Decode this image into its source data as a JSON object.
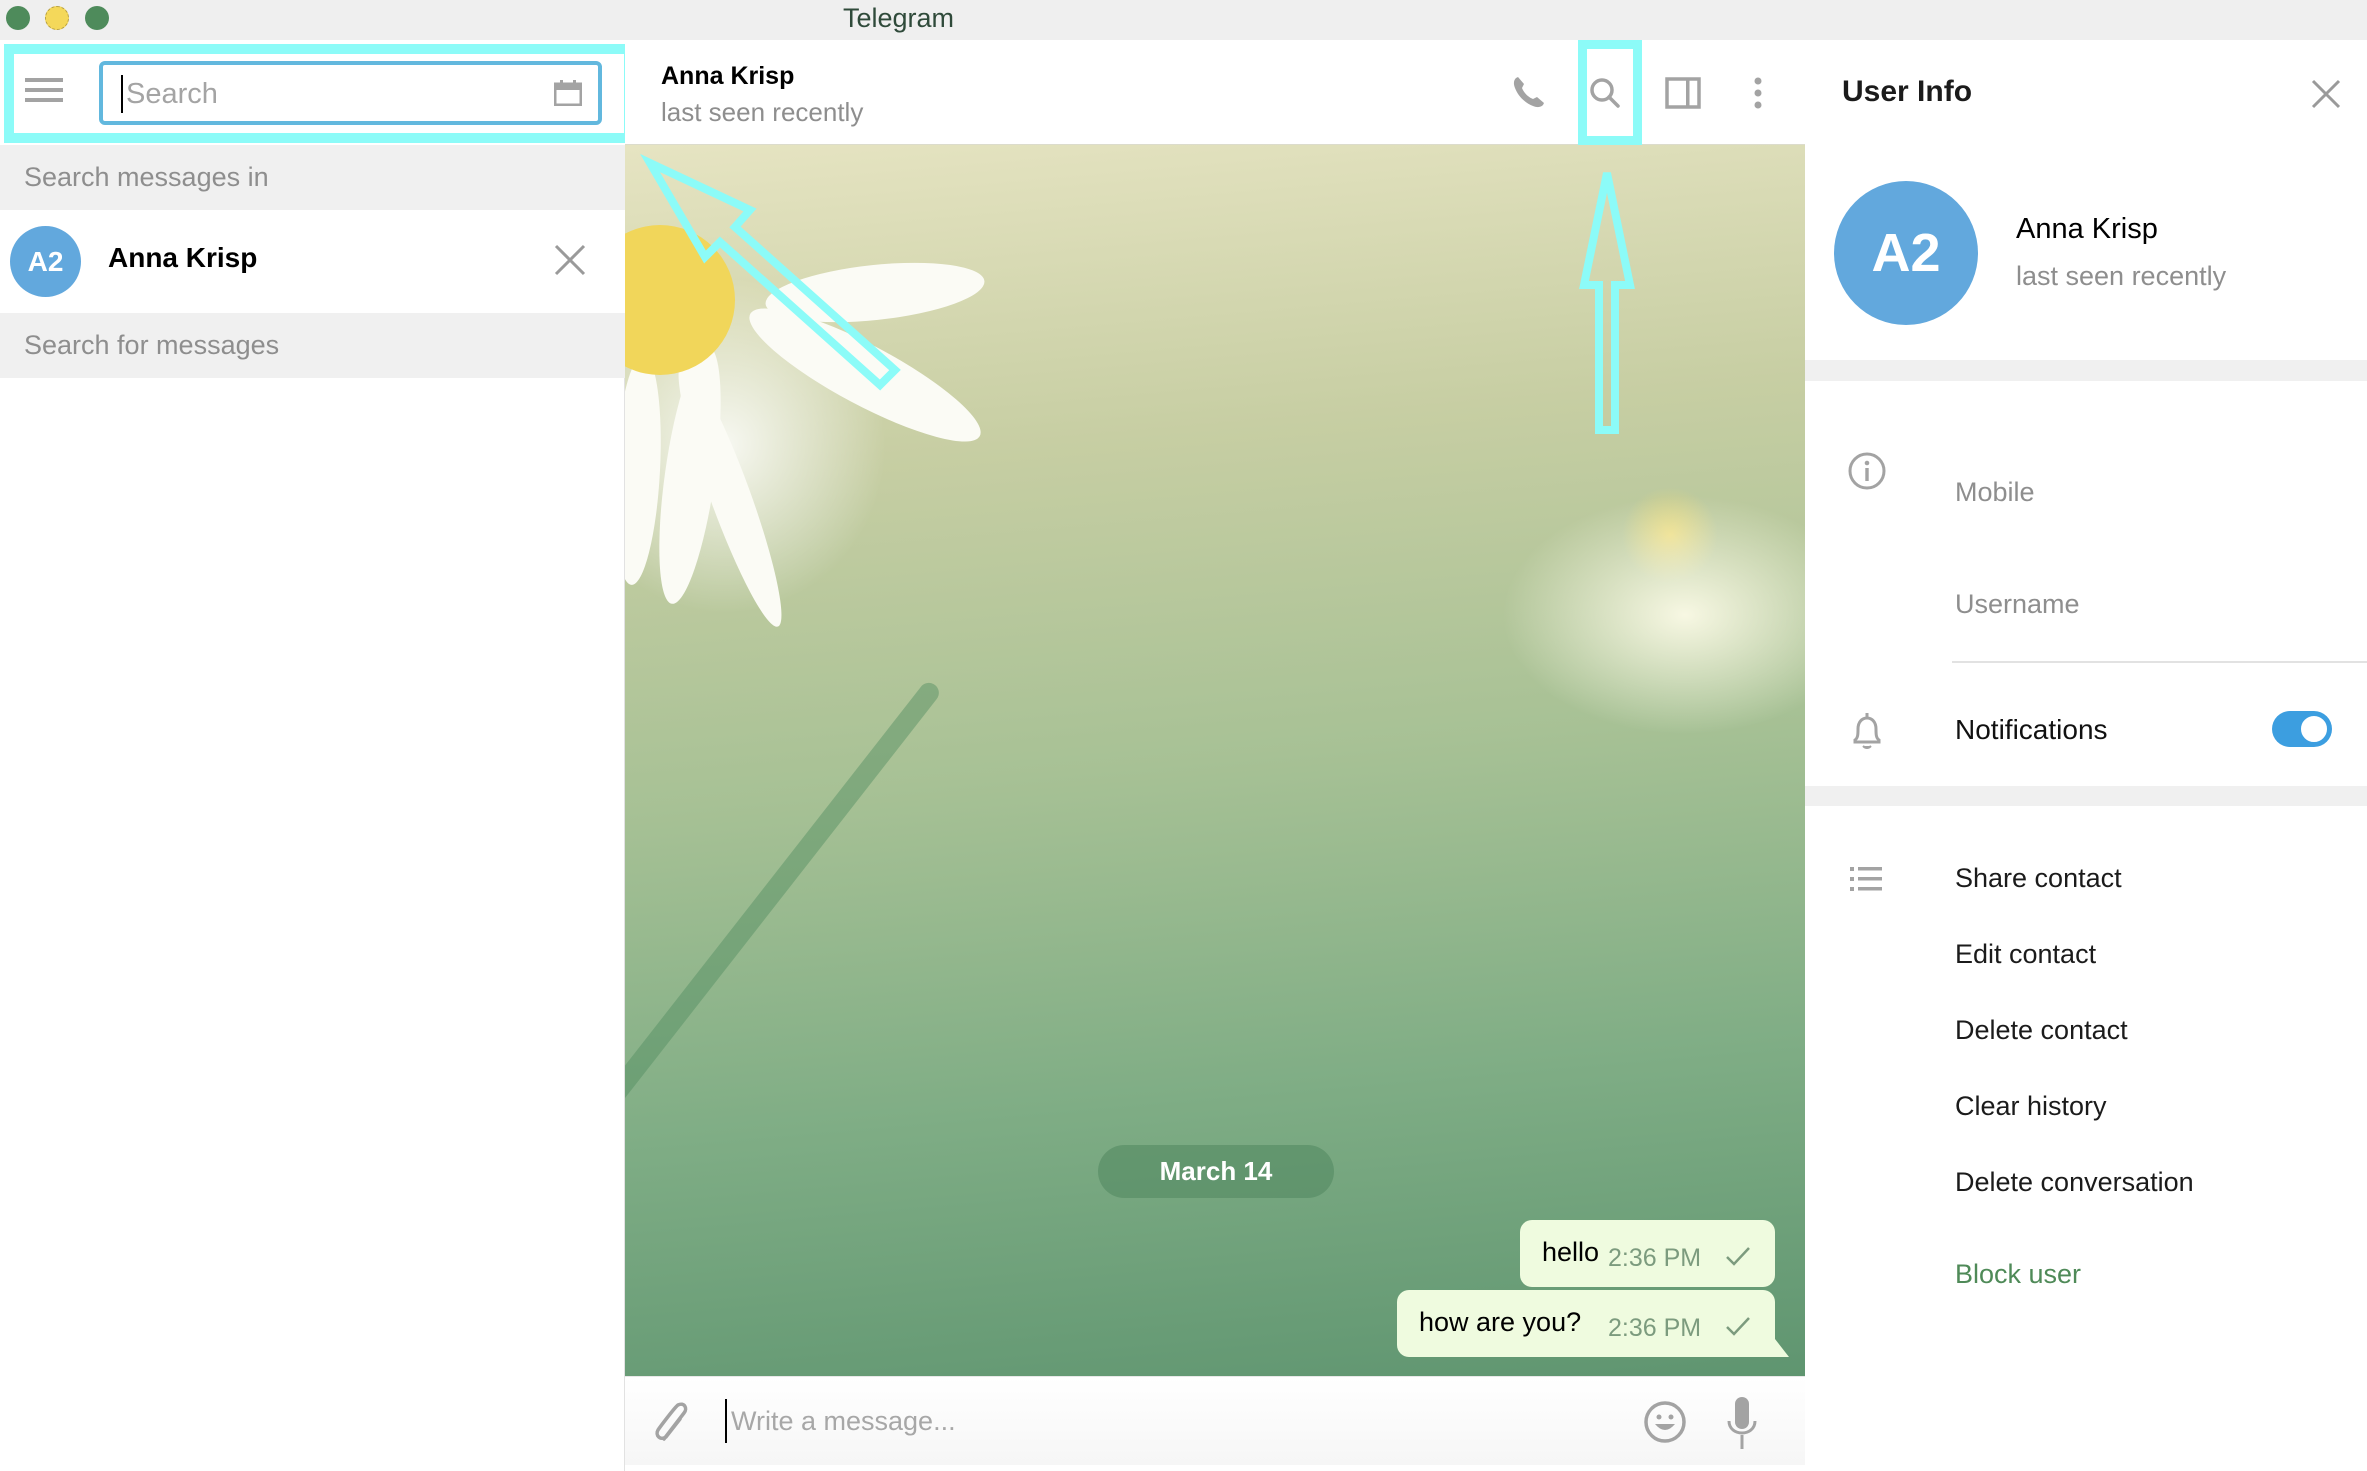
{
  "window": {
    "title": "Telegram"
  },
  "sidebar": {
    "search": {
      "placeholder": "Search",
      "value": ""
    },
    "search_messages_in_label": "Search messages in",
    "scope_chat": {
      "avatar_initials": "A2",
      "name": "Anna Krisp"
    },
    "search_for_messages_label": "Search for messages"
  },
  "chat": {
    "header": {
      "name": "Anna Krisp",
      "status": "last seen recently"
    },
    "date_separator": "March 14",
    "messages": [
      {
        "text": "hello",
        "time": "2:36 PM",
        "status": "sent"
      },
      {
        "text": "how are you?",
        "time": "2:36 PM",
        "status": "sent"
      }
    ],
    "composer": {
      "placeholder": "Write a message...",
      "value": ""
    }
  },
  "user_info": {
    "title": "User Info",
    "avatar_initials": "A2",
    "name": "Anna Krisp",
    "status": "last seen recently",
    "fields": {
      "mobile_label": "Mobile",
      "username_label": "Username"
    },
    "notifications": {
      "label": "Notifications",
      "enabled": true
    },
    "actions": [
      "Share contact",
      "Edit contact",
      "Delete contact",
      "Clear history",
      "Delete conversation"
    ],
    "block_label": "Block user"
  },
  "colors": {
    "accent": "#62a8dd",
    "toggle_on": "#3c9ee0",
    "annotation_highlight": "#8cfbf8",
    "bubble_out": "#effbdf",
    "block_action": "#4f8a58"
  }
}
